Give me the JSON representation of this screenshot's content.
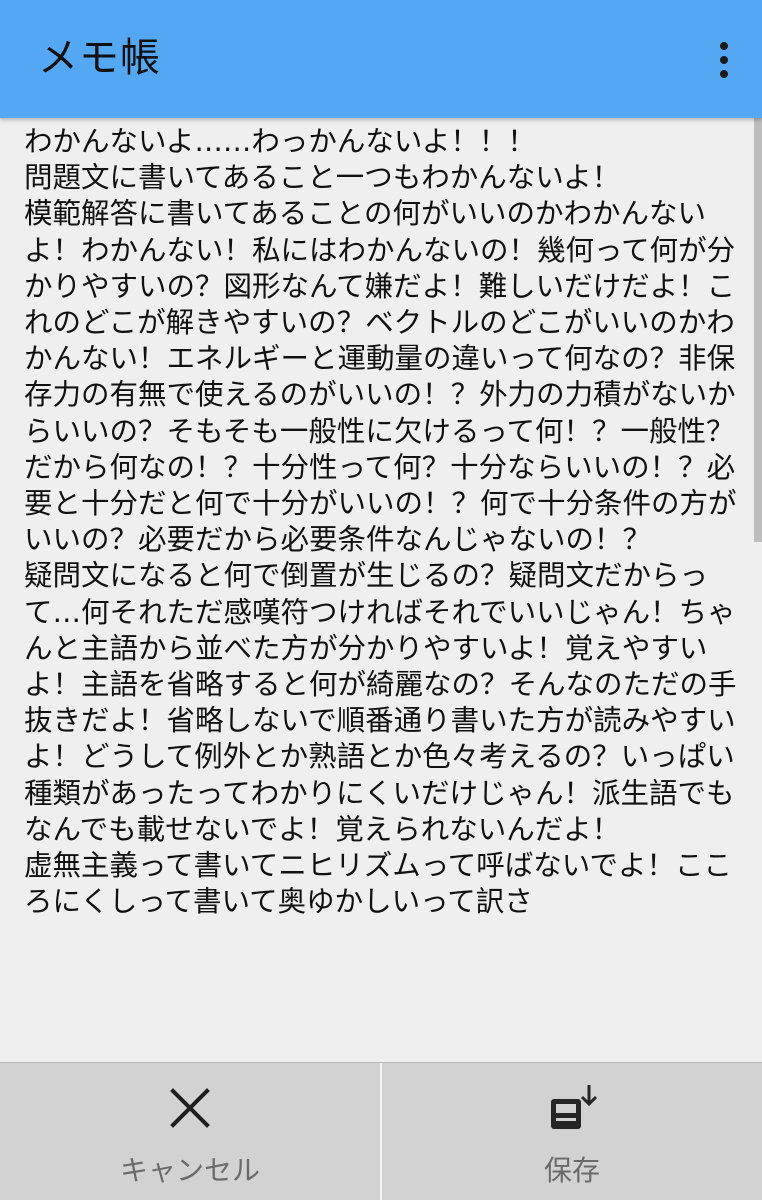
{
  "appbar": {
    "title": "メモ帳",
    "menu_icon": "more-vertical-icon"
  },
  "editor": {
    "content": "わかんないよ……わっかんないよ！！！\n問題文に書いてあること一つもわかんないよ！\n模範解答に書いてあることの何がいいのかわかんないよ！わかんない！私にはわかんないの！幾何って何が分かりやすいの？図形なんて嫌だよ！難しいだけだよ！これのどこが解きやすいの？ベクトルのどこがいいのかわかんない！エネルギーと運動量の違いって何なの？非保存力の有無で使えるのがいいの！？外力の力積がないからいいの？そもそも一般性に欠けるって何！？一般性？だから何なの！？十分性って何？十分ならいいの！？必要と十分だと何で十分がいいの！？何で十分条件の方がいいの？必要だから必要条件なんじゃないの！？\n疑問文になると何で倒置が生じるの？疑問文だからって…何それただ感嘆符つければそれでいいじゃん！ちゃんと主語から並べた方が分かりやすいよ！覚えやすいよ！主語を省略すると何が綺麗なの？そんなのただの手抜きだよ！省略しないで順番通り書いた方が読みやすいよ！どうして例外とか熟語とか色々考えるの？いっぱい種類があったってわかりにくいだけじゃん！派生語でもなんでも載せないでよ！覚えられないんだよ！\n虚無主義って書いてニヒリズムって呼ばないでよ！こころにくしって書いて奥ゆかしいって訳さ"
  },
  "bottombar": {
    "cancel": {
      "label": "キャンセル",
      "icon": "close-icon"
    },
    "save": {
      "label": "保存",
      "icon": "save-to-storage-icon"
    }
  }
}
